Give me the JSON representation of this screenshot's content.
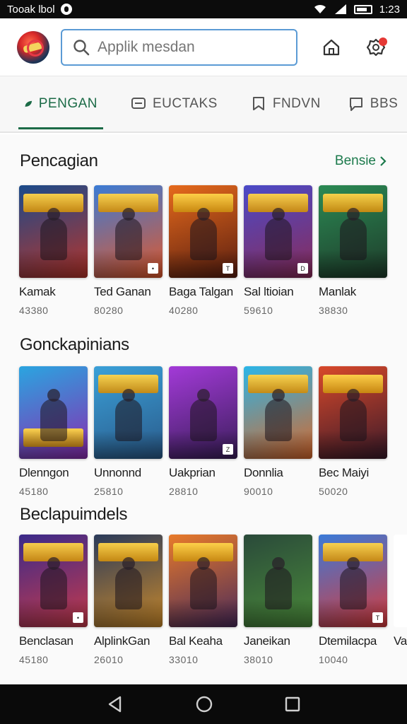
{
  "status_bar": {
    "left_text": "Tooak lbol",
    "time": "1:23"
  },
  "header": {
    "search_placeholder": "Applik mesdan"
  },
  "tabs": [
    {
      "label": "PENGAN",
      "active": true
    },
    {
      "label": "EUCTAKS",
      "active": false
    },
    {
      "label": "FNDVN",
      "active": false
    },
    {
      "label": "BBS",
      "active": false
    }
  ],
  "sections": [
    {
      "title": "Pencagian",
      "see_more": "Bensie",
      "items": [
        {
          "title": "Kamak",
          "sub": "43380",
          "colors": [
            "#1a4a8a",
            "#b8342a"
          ],
          "badge": ""
        },
        {
          "title": "Ted Ganan",
          "sub": "80280",
          "colors": [
            "#3a7bd5",
            "#e2582a"
          ],
          "badge": "•"
        },
        {
          "title": "Baga Talgan",
          "sub": "40280",
          "colors": [
            "#e66a1c",
            "#5a1e10"
          ],
          "badge": "T"
        },
        {
          "title": "Sal ltioian",
          "sub": "59610",
          "colors": [
            "#4a4ac8",
            "#8a2b58"
          ],
          "badge": "D"
        },
        {
          "title": "Manlak",
          "sub": "38830",
          "colors": [
            "#2b8a54",
            "#1e3b2a"
          ],
          "badge": ""
        }
      ]
    },
    {
      "title": "Gonckapinians",
      "see_more": "",
      "items": [
        {
          "title": "Dlenngon",
          "sub": "45180",
          "colors": [
            "#2aa5e0",
            "#8a2bb0"
          ],
          "badge": ""
        },
        {
          "title": "Unnonnd",
          "sub": "25810",
          "colors": [
            "#3aa0d8",
            "#2a5a8a"
          ],
          "badge": ""
        },
        {
          "title": "Uakprian",
          "sub": "28810",
          "colors": [
            "#a33ad8",
            "#3a1e5a"
          ],
          "badge": "Z"
        },
        {
          "title": "Donnlia",
          "sub": "90010",
          "colors": [
            "#2ab5e8",
            "#d8672a"
          ],
          "badge": ""
        },
        {
          "title": "Bec Maiyi",
          "sub": "50020",
          "colors": [
            "#d8482a",
            "#3a1a2a"
          ],
          "badge": ""
        }
      ]
    },
    {
      "title": "Beclapuimdels",
      "see_more": "",
      "items": [
        {
          "title": "Benclasan",
          "sub": "45180",
          "colors": [
            "#3a2a8a",
            "#c83a4a"
          ],
          "badge": "•"
        },
        {
          "title": "AlplinkGan",
          "sub": "26010",
          "colors": [
            "#2a3a5a",
            "#c8882a"
          ],
          "badge": ""
        },
        {
          "title": "Bal Keaha",
          "sub": "33010",
          "colors": [
            "#e87a2a",
            "#4a2a5a"
          ],
          "badge": ""
        },
        {
          "title": "Janeikan",
          "sub": "38010",
          "colors": [
            "#2a4a3a",
            "#4a8a3a"
          ],
          "badge": ""
        },
        {
          "title": "Dtemilacpa",
          "sub": "10040",
          "colors": [
            "#3a7ad8",
            "#d83a3a"
          ],
          "badge": "T"
        },
        {
          "title": "Va",
          "sub": "",
          "colors": [
            "#ffffff",
            "#ffffff"
          ],
          "badge": ""
        }
      ]
    }
  ]
}
